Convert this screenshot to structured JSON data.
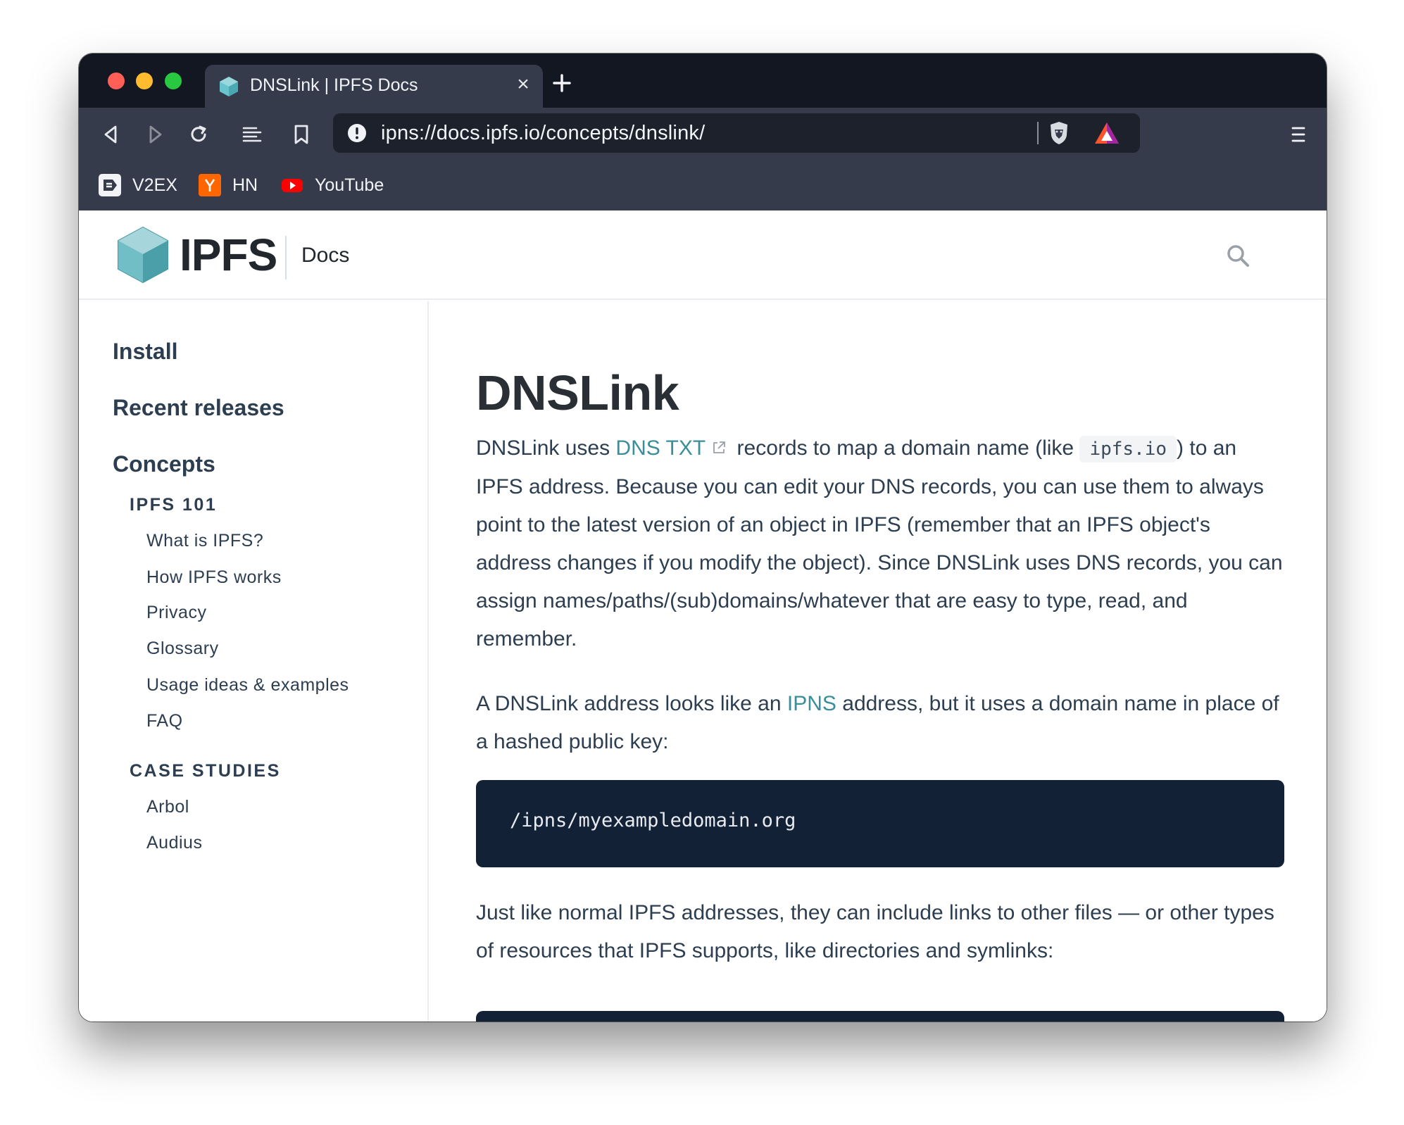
{
  "browser": {
    "tab": {
      "title": "DNSLink | IPFS Docs",
      "close_glyph": "×"
    },
    "address_bar": {
      "url": "ipns://docs.ipfs.io/concepts/dnslink/"
    },
    "bookmarks": [
      {
        "label": "V2EX",
        "icon": "v2ex-icon",
        "color": "#f2f3f7"
      },
      {
        "label": "HN",
        "icon": "hacker-news-icon",
        "color": "#ff6600"
      },
      {
        "label": "YouTube",
        "icon": "youtube-icon",
        "color": "#ff0000"
      }
    ]
  },
  "site": {
    "logo_text": "IPFS",
    "section": "Docs",
    "accent_color": "#3b8f9a"
  },
  "sidebar": {
    "items": [
      {
        "label": "Install"
      },
      {
        "label": "Recent releases"
      },
      {
        "label": "Concepts"
      },
      {
        "label": "IPFS 101"
      },
      {
        "label": "What is IPFS?"
      },
      {
        "label": "How IPFS works"
      },
      {
        "label": "Privacy"
      },
      {
        "label": "Glossary"
      },
      {
        "label": "Usage ideas & examples"
      },
      {
        "label": "FAQ"
      },
      {
        "label": "CASE STUDIES"
      },
      {
        "label": "Arbol"
      },
      {
        "label": "Audius"
      }
    ]
  },
  "content": {
    "title": "DNSLink",
    "p1": {
      "before": "DNSLink uses ",
      "link": "DNS TXT",
      "middle": " records to map a domain name (like ",
      "code": "ipfs.io",
      "after": ") to an IPFS address. Because you can edit your DNS records, you can use them to always point to the latest version of an object in IPFS (remember that an IPFS object's address changes if you modify the object). Since DNSLink uses DNS records, you can assign names/paths/(sub)domains/whatever that are easy to type, read, and remember."
    },
    "p2": {
      "before": "A DNSLink address looks like an ",
      "link": "IPNS",
      "after": " address, but it uses a domain name in place of a hashed public key:"
    },
    "code_block": "/ipns/myexampledomain.org",
    "p3": "Just like normal IPFS addresses, they can include links to other files — or other types of resources that IPFS supports, like directories and symlinks:"
  }
}
